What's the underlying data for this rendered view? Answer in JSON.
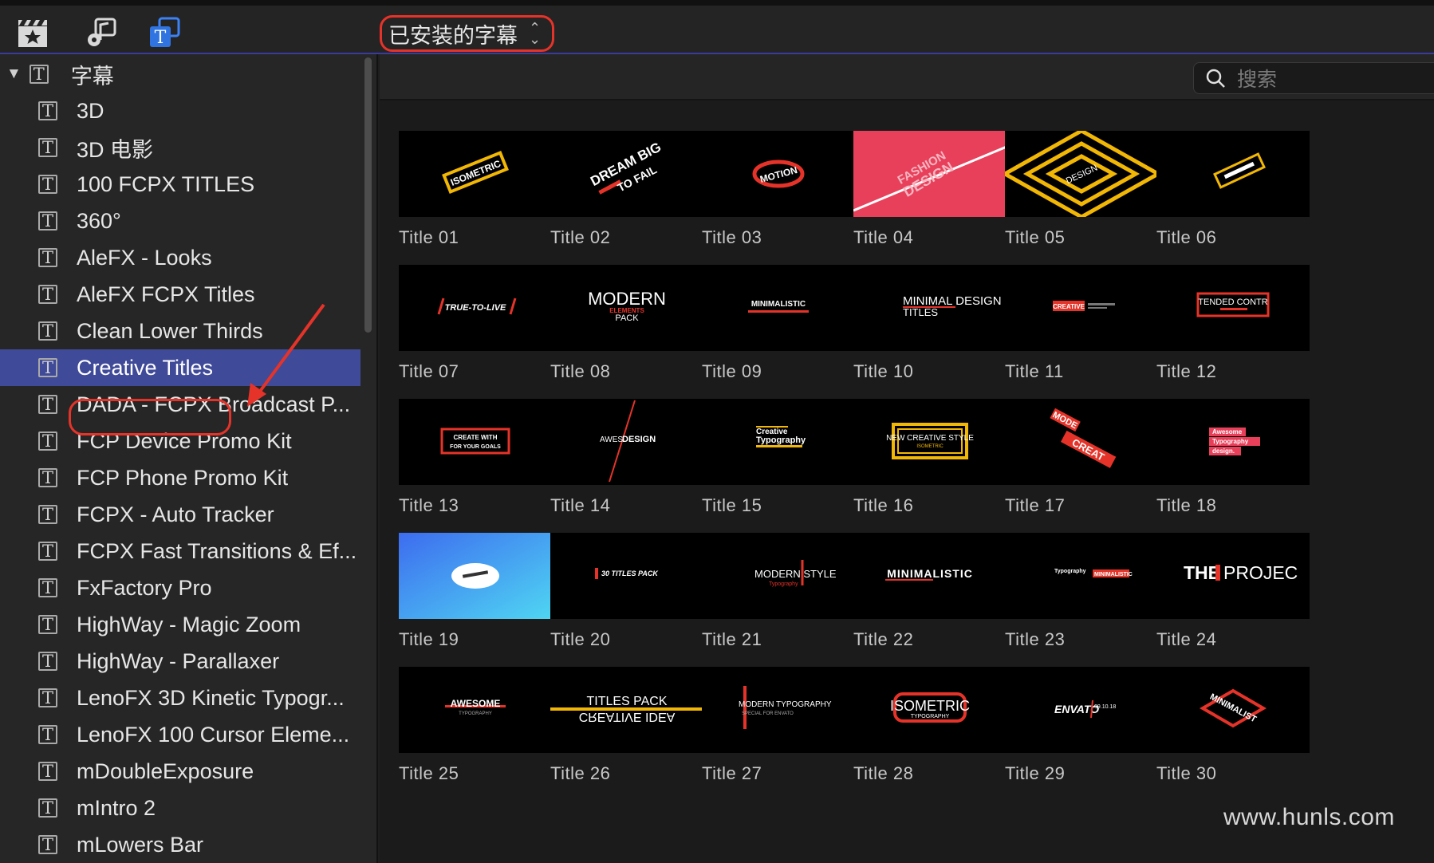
{
  "toolbar": {
    "icons": [
      "clapper-star-icon",
      "music-photo-icon",
      "titles-icon"
    ],
    "source_selector": "已安装的字幕"
  },
  "search": {
    "placeholder": "搜索"
  },
  "sidebar": {
    "root_label": "字幕",
    "items": [
      "3D",
      "3D 电影",
      "100 FCPX TITLES",
      "360°",
      "AleFX - Looks",
      "AleFX FCPX Titles",
      "Clean Lower Thirds",
      "Creative Titles",
      "DADA - FCPX Broadcast P...",
      "FCP Device Promo Kit",
      "FCP Phone Promo Kit",
      "FCPX - Auto Tracker",
      "FCPX Fast Transitions & Ef...",
      "FxFactory Pro",
      "HighWay - Magic Zoom",
      "HighWay - Parallaxer",
      "LenoFX 3D Kinetic Typogr...",
      "LenoFX 100 Cursor Eleme...",
      "mDoubleExposure",
      "mIntro 2",
      "mLowers Bar"
    ],
    "selected_index": 7
  },
  "titles": [
    "Title 01",
    "Title 02",
    "Title 03",
    "Title 04",
    "Title 05",
    "Title 06",
    "Title 07",
    "Title 08",
    "Title 09",
    "Title 10",
    "Title 11",
    "Title 12",
    "Title 13",
    "Title 14",
    "Title 15",
    "Title 16",
    "Title 17",
    "Title 18",
    "Title 19",
    "Title 20",
    "Title 21",
    "Title 22",
    "Title 23",
    "Title 24",
    "Title 25",
    "Title 26",
    "Title 27",
    "Title 28",
    "Title 29",
    "Title 30"
  ],
  "thumb_text": {
    "t1": "ISOMETRIC",
    "t2": "DREAM BIG",
    "t2b": "TO FAIL",
    "t3": "MOTION",
    "t4": "FASHION",
    "t4b": "DESIGN",
    "t5": "DESIGN",
    "t7": "TRUE-TO-LIVE",
    "t8": "MODERN",
    "t8b": "ELEMENTS",
    "t8c": "PACK",
    "t9": "MINIMALISTIC",
    "t10": "MINIMAL DESIGN",
    "t10b": "TITLES",
    "t11": "CREATIVE",
    "t12": "TENDED CONTR",
    "t13": "CREATE WITH",
    "t13b": "FOR YOUR GOALS",
    "t14a": "AWES",
    "t14b": "DESIGN",
    "t15": "Creative",
    "t15b": "Typography",
    "t16": "NEW CREATIVE STYLE",
    "t16b": "ISOMETRIC",
    "t17": "MODE",
    "t17b": "CREAT",
    "t18": "Awesome",
    "t18b": "Typography",
    "t18c": "design.",
    "t20": "30 TITLES PACK",
    "t21": "MODERN STYLE",
    "t21b": "Typography",
    "t22": "MINIMALISTIC",
    "t23": "Typography",
    "t23b": "MINIMALISTIC",
    "t24a": "THE",
    "t24b": "PROJEC",
    "t25": "AWESOME",
    "t25b": "TYPOGRAPHY",
    "t26": "TITLES PACK",
    "t26b": "CREATIVE IDEA",
    "t27": "MODERN TYPOGRAPHY",
    "t27b": "SPECIAL FOR ENVATO",
    "t28": "ISOMETRIC",
    "t28b": "TYPOGRAPHY",
    "t29": "ENVATO",
    "t29b": "09.10.18",
    "t30": "MINIMALIST"
  },
  "watermark": "www.hunls.com",
  "colors": {
    "accent_red": "#e53329",
    "selection_blue": "#3f4a98",
    "toolbar_underline": "#3b3a9e"
  }
}
